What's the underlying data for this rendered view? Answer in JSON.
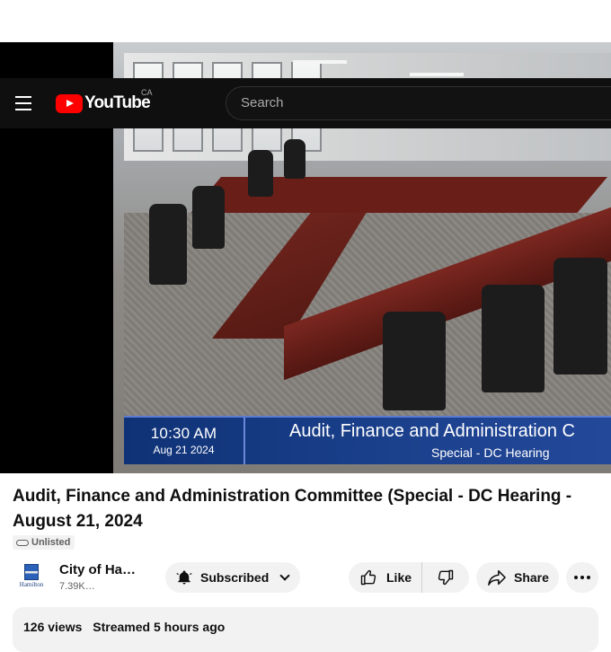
{
  "masthead": {
    "logo_text": "YouTube",
    "country_code": "CA",
    "search_placeholder": "Search"
  },
  "player": {
    "overlay_time": "10:30 AM",
    "overlay_date": "Aug 21 2024",
    "overlay_title": "Audit, Finance and Administration C",
    "overlay_subtitle": "Special - DC Hearing"
  },
  "video": {
    "title": "Audit, Finance and Administration Committee (Special - DC Hearing - August 21, 2024",
    "visibility": "Unlisted"
  },
  "owner": {
    "channel_name": "City of Ha…",
    "subscribers": "7.39K…",
    "avatar_text": "Hamilton"
  },
  "actions": {
    "subscribed_label": "Subscribed",
    "like_label": "Like",
    "share_label": "Share"
  },
  "description": {
    "views": "126 views",
    "streamed": "Streamed 5 hours ago"
  },
  "colors": {
    "brand_red": "#ff0000",
    "lower_third_blue": "#1a3f8a",
    "pill_bg": "#f2f2f2"
  }
}
